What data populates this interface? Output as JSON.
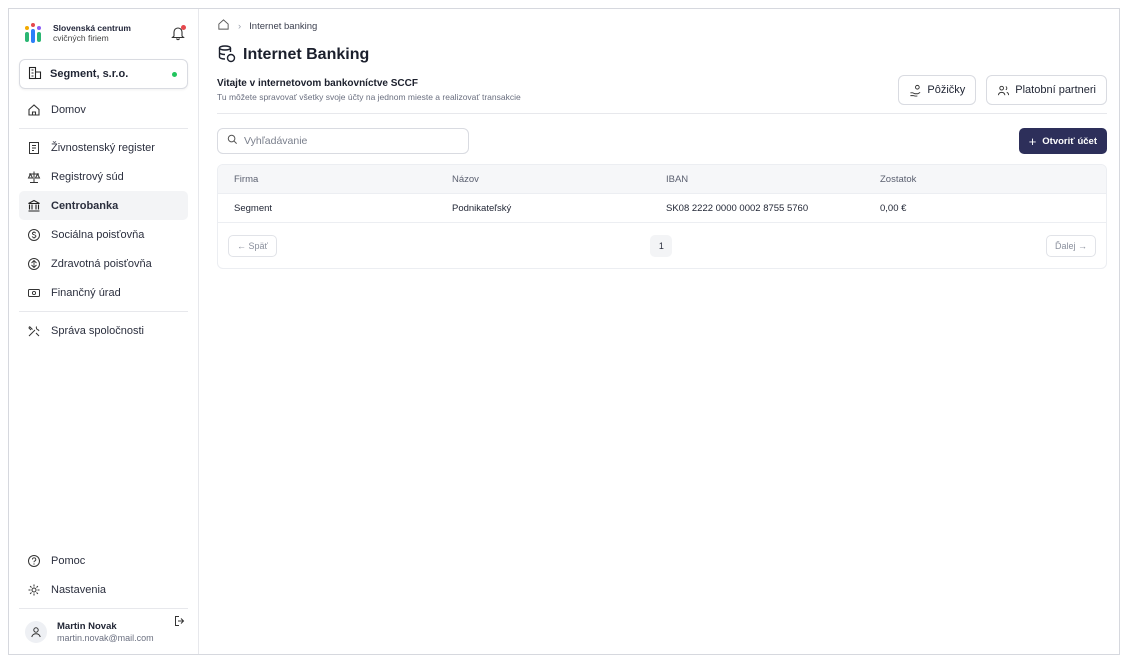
{
  "brand": {
    "line1": "Slovenská centrum",
    "line2": "cvičných firiem"
  },
  "company": {
    "name": "Segment, s.r.o."
  },
  "nav": {
    "home": "Domov",
    "items": [
      {
        "label": "Živnostenský register",
        "icon": "trade-register-icon"
      },
      {
        "label": "Registrový súd",
        "icon": "scales-icon"
      },
      {
        "label": "Centrobanka",
        "icon": "bank-icon"
      },
      {
        "label": "Sociálna poisťovňa",
        "icon": "social-insurance-icon"
      },
      {
        "label": "Zdravotná poisťovňa",
        "icon": "health-insurance-icon"
      },
      {
        "label": "Finančný úrad",
        "icon": "tax-office-icon"
      }
    ],
    "manage": "Správa spoločnosti",
    "help": "Pomoc",
    "settings": "Nastavenia"
  },
  "user": {
    "name": "Martin Novak",
    "email": "martin.novak@mail.com"
  },
  "breadcrumb": {
    "current": "Internet banking"
  },
  "page": {
    "title": "Internet Banking",
    "welcome": "Vitajte v internetovom bankovníctve SCCF",
    "subtitle": "Tu môžete spravovať všetky svoje účty na jednom mieste a realizovať transakcie",
    "loans_button": "Pôžičky",
    "partners_button": "Platobní partneri"
  },
  "search": {
    "placeholder": "Vyhľadávanie"
  },
  "open_account_button": "Otvoriť účet",
  "table": {
    "headers": [
      "Firma",
      "Názov",
      "IBAN",
      "Zostatok"
    ],
    "rows": [
      [
        "Segment",
        "Podnikateľský",
        "SK08 2222 0000 0002 8755 5760",
        "0,00 €"
      ]
    ]
  },
  "pagination": {
    "prev": "← Späť",
    "page": "1",
    "next": "Ďalej →"
  },
  "colors": {
    "primary": "#2d2f5a",
    "status_ok": "#22c55e",
    "notification": "#e5484d"
  }
}
